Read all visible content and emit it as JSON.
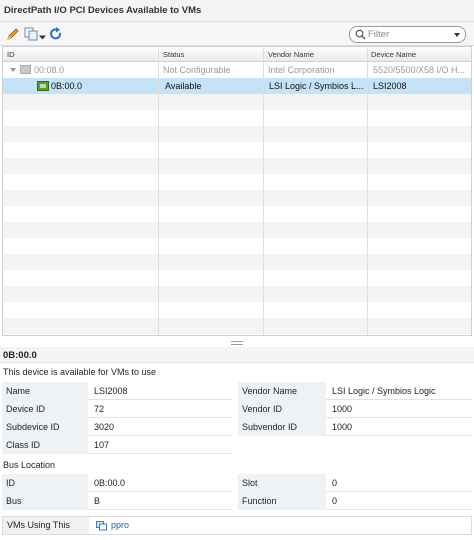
{
  "panel": {
    "title": "DirectPath I/O PCI Devices Available to VMs"
  },
  "toolbar": {
    "edit_icon": "pencil-icon",
    "copy_icon": "copy-icon",
    "refresh_icon": "refresh-icon",
    "filter_placeholder": "Filter"
  },
  "grid": {
    "columns": [
      "ID",
      "Status",
      "Vendor Name",
      "Device Name"
    ],
    "rows": [
      {
        "id": "00:08.0",
        "status": "Not Configurable",
        "vendor": "Intel Corporation",
        "device": "5520/5500/X58 I/O H...",
        "state": "disabled"
      },
      {
        "id": "0B:00.0",
        "status": "Available",
        "vendor": "LSI Logic / Symbios L...",
        "device": "LSI2008",
        "state": "selected"
      }
    ]
  },
  "details": {
    "heading": "0B:00.0",
    "availability": "This device is available for VMs to use",
    "left": [
      {
        "k": "Name",
        "v": "LSI2008"
      },
      {
        "k": "Device ID",
        "v": "72"
      },
      {
        "k": "Subdevice ID",
        "v": "3020"
      },
      {
        "k": "Class ID",
        "v": "107"
      }
    ],
    "right": [
      {
        "k": "Vendor Name",
        "v": "LSI Logic / Symbios Logic"
      },
      {
        "k": "Vendor ID",
        "v": "1000"
      },
      {
        "k": "Subvendor ID",
        "v": "1000"
      }
    ],
    "bus_location": {
      "title": "Bus Location",
      "left": [
        {
          "k": "ID",
          "v": "0B:00.0"
        },
        {
          "k": "Bus",
          "v": "B"
        }
      ],
      "right": [
        {
          "k": "Slot",
          "v": "0"
        },
        {
          "k": "Function",
          "v": "0"
        }
      ]
    },
    "vms": {
      "label": "VMs Using This",
      "vm": "ppro"
    }
  },
  "colors": {
    "selection": "#c6e2f6",
    "label_bg": "#eef2f5",
    "link": "#1a5fb4"
  }
}
